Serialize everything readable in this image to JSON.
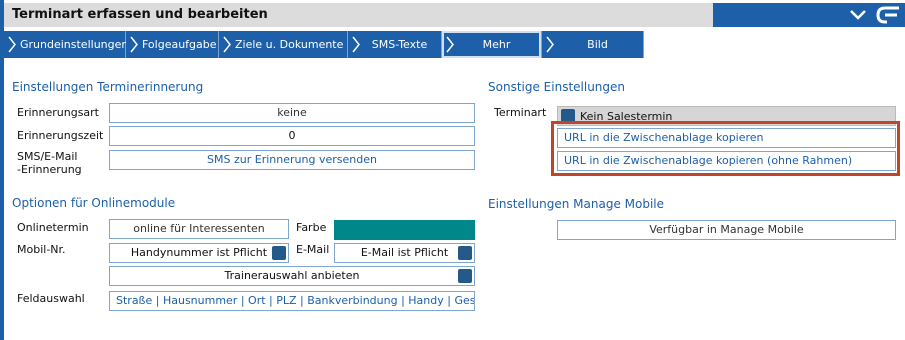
{
  "window": {
    "title": "Terminart erfassen und bearbeiten"
  },
  "tabs": [
    {
      "label": "Grundeinstellungen"
    },
    {
      "label": "Folgeaufgabe"
    },
    {
      "label": "Ziele u. Dokumente"
    },
    {
      "label": "SMS-Texte"
    },
    {
      "label": "Mehr"
    },
    {
      "label": "Bild"
    }
  ],
  "reminder": {
    "title": "Einstellungen Terminerinnerung",
    "type_label": "Erinnerungsart",
    "type_value": "keine",
    "time_label": "Erinnerungszeit",
    "time_value": "0",
    "sms_label_line1": "SMS/E-Mail",
    "sms_label_line2": "-Erinnerung",
    "sms_value": "SMS zur Erinnerung versenden"
  },
  "online": {
    "title": "Optionen für Onlinemodule",
    "onlinetermin_label": "Onlinetermin",
    "onlinetermin_value": "online für Interessenten",
    "farbe_label": "Farbe",
    "mobil_label": "Mobil-Nr.",
    "mobil_value": "Handynummer ist Pflicht",
    "email_label": "E-Mail",
    "email_value": "E-Mail ist Pflicht",
    "trainer_value": "Trainerauswahl anbieten",
    "feld_label": "Feldauswahl",
    "feld_value": "Straße | Hausnummer | Ort | PLZ | Bankverbindung | Handy | Gesch"
  },
  "other": {
    "title": "Sonstige Einstellungen",
    "terminart_label": "Terminart",
    "terminart_value": "Kein Salestermin",
    "url_copy": "URL in die Zwischenablage kopieren",
    "url_copy_noframe": "URL in die Zwischenablage kopieren (ohne Rahmen)"
  },
  "mobile": {
    "title": "Einstellungen Manage Mobile",
    "value": "Verfügbar in Manage Mobile"
  },
  "colors": {
    "accent": "#1d5fa8",
    "farbe": "#00878a",
    "highlight": "#c0462a"
  }
}
